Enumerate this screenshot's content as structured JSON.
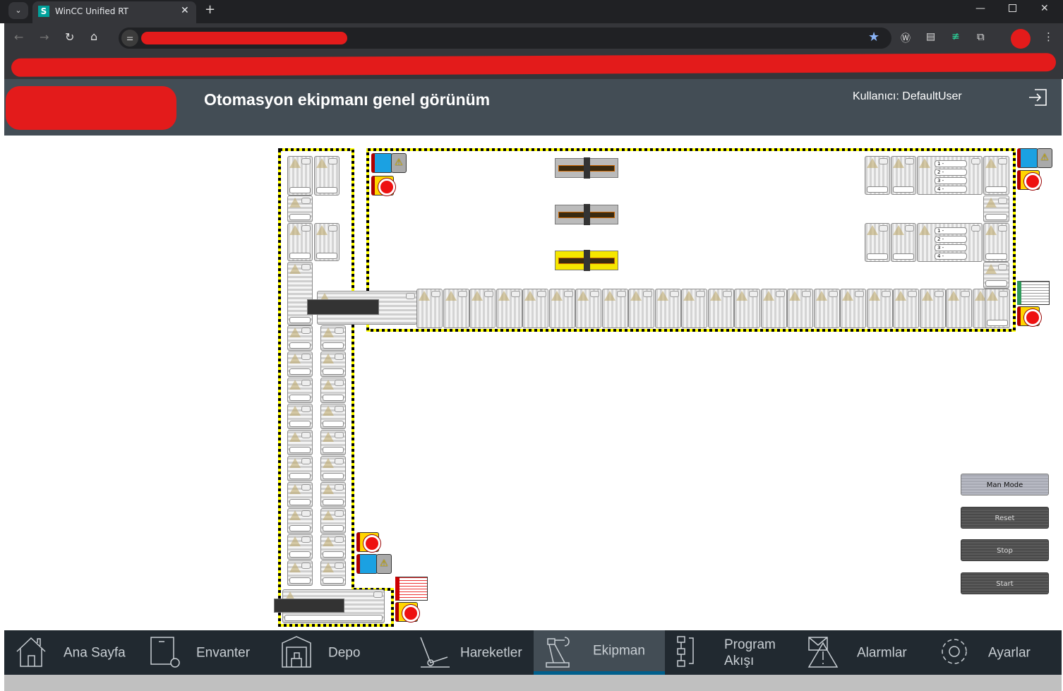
{
  "browser": {
    "tab_title": "WinCC Unified RT",
    "favicon_letter": "S",
    "favicon_color": "#00a19b"
  },
  "header": {
    "title": "Otomasyon ekipmanı genel görünüm",
    "user_label": "Kullanıcı: DefaultUser"
  },
  "controls": [
    {
      "label": "Man Mode"
    },
    {
      "label": "Reset"
    },
    {
      "label": "Stop"
    },
    {
      "label": "Start"
    }
  ],
  "station_list": [
    "1 -",
    "2 -",
    "3 -",
    "4 -"
  ],
  "nav": {
    "active": "Ekipman",
    "items": [
      {
        "label": "Ana Sayfa",
        "icon": "home-icon"
      },
      {
        "label": "Envanter",
        "icon": "inventory-icon"
      },
      {
        "label": "Depo",
        "icon": "warehouse-icon"
      },
      {
        "label": "Hareketler",
        "icon": "hand-truck-icon"
      },
      {
        "label": "Ekipman",
        "icon": "robot-arm-icon"
      },
      {
        "label": "Program Akışı",
        "icon": "flowchart-icon"
      },
      {
        "label": "Alarmlar",
        "icon": "alarm-icon"
      },
      {
        "label": "Ayarlar",
        "icon": "gear-icon"
      }
    ]
  },
  "colors": {
    "header_bg": "#434d55",
    "nav_bg": "#212930",
    "nav_active_underline": "#005f8c",
    "safety_yellow": "#ffff00",
    "redaction": "#e31b1b"
  }
}
